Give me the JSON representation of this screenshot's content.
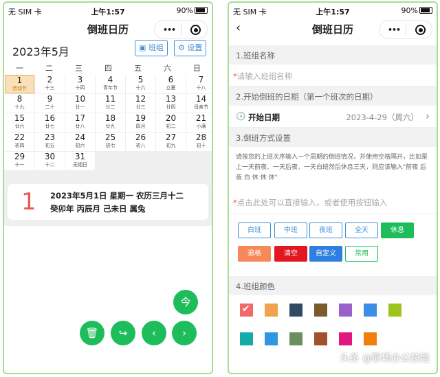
{
  "status": {
    "carrier": "无 SIM 卡",
    "time": "上午1:57",
    "battery": "90%"
  },
  "nav": {
    "title": "倒班日历",
    "more": "•••"
  },
  "calendar": {
    "month": "2023年5月",
    "btn_shift": "班组",
    "btn_settings": "设置",
    "weekdays": [
      "一",
      "二",
      "三",
      "四",
      "五",
      "六",
      "日"
    ],
    "days": [
      {
        "d": "1",
        "l": "劳动节"
      },
      {
        "d": "2",
        "l": "十三"
      },
      {
        "d": "3",
        "l": "十四"
      },
      {
        "d": "4",
        "l": "青年节"
      },
      {
        "d": "5",
        "l": "十六"
      },
      {
        "d": "6",
        "l": "立夏"
      },
      {
        "d": "7",
        "l": "十八"
      },
      {
        "d": "8",
        "l": "十九"
      },
      {
        "d": "9",
        "l": "二十"
      },
      {
        "d": "10",
        "l": "廿一"
      },
      {
        "d": "11",
        "l": "廿二"
      },
      {
        "d": "12",
        "l": "廿三"
      },
      {
        "d": "13",
        "l": "廿四"
      },
      {
        "d": "14",
        "l": "母亲节"
      },
      {
        "d": "15",
        "l": "廿六"
      },
      {
        "d": "16",
        "l": "廿七"
      },
      {
        "d": "17",
        "l": "廿八"
      },
      {
        "d": "18",
        "l": "廿九"
      },
      {
        "d": "19",
        "l": "四月"
      },
      {
        "d": "20",
        "l": "初二"
      },
      {
        "d": "21",
        "l": "小满"
      },
      {
        "d": "22",
        "l": "初四"
      },
      {
        "d": "23",
        "l": "初五"
      },
      {
        "d": "24",
        "l": "初六"
      },
      {
        "d": "25",
        "l": "初七"
      },
      {
        "d": "26",
        "l": "初八"
      },
      {
        "d": "27",
        "l": "初九"
      },
      {
        "d": "28",
        "l": "初十"
      },
      {
        "d": "29",
        "l": "十一"
      },
      {
        "d": "30",
        "l": "十二"
      },
      {
        "d": "31",
        "l": "无烟日"
      }
    ]
  },
  "info": {
    "day": "1",
    "line1": "2023年5月1日 星期一 农历三月十二",
    "line2": "癸卯年 丙辰月 己未日 属兔"
  },
  "fab": {
    "today": "今"
  },
  "form": {
    "sec1": "1.班组名称",
    "name_placeholder": "请输入班组名称",
    "sec2": "2.开始倒班的日期（第一个班次的日期）",
    "start_label": "开始日期",
    "start_value": "2023-4-29（周六）",
    "sec3": "3.倒班方式设置",
    "desc": "请按您的上班次序输入一个周期的倒班情况，并使用空格隔开，比如是上一天前夜、一天后夜、一天白班然后休息三天，则应该输入\"前夜 后夜 白 休 休 休\"",
    "pattern_placeholder": "点击此处可以直接输入，或者使用按钮输入",
    "buttons": [
      "白班",
      "中班",
      "夜班",
      "全天",
      "休息",
      "退格",
      "清空",
      "自定义",
      "常用"
    ],
    "sec4": "4.班组颜色",
    "colors": [
      "#f06a6a",
      "#f2a24a",
      "#2f4a63",
      "#7b5a2e",
      "#9a62c9",
      "#3a8ee6",
      "#9cc41e",
      "#16a9a9",
      "#2f96e2",
      "#6a8f60",
      "#a0522d",
      "#e0177d",
      "#f07f0a"
    ]
  },
  "watermark": "头条 @职场办公技能"
}
